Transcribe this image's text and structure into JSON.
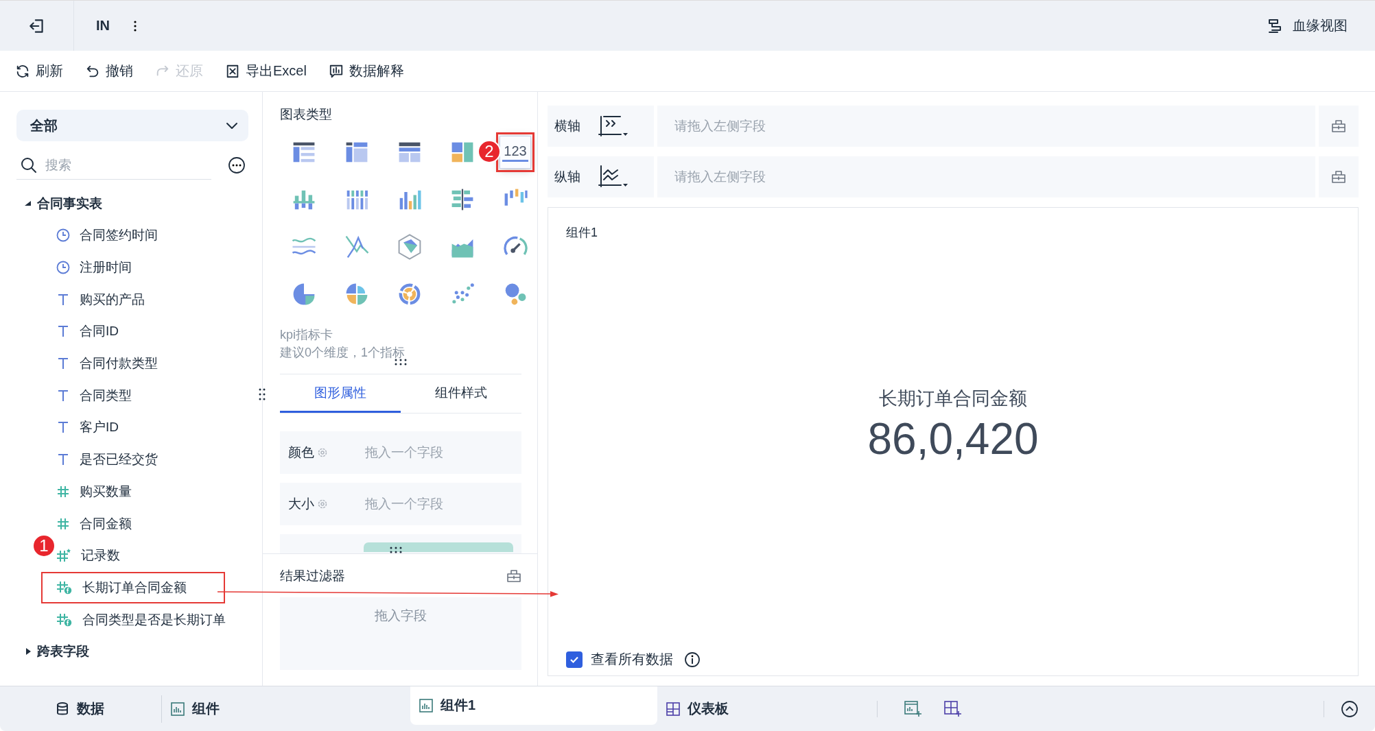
{
  "top_bar": {
    "title": "IN",
    "lineage_button": "血缘视图"
  },
  "toolbar": [
    {
      "label": "刷新",
      "kind": "refresh",
      "disabled": false
    },
    {
      "label": "撤销",
      "kind": "undo",
      "disabled": false
    },
    {
      "label": "还原",
      "kind": "redo",
      "disabled": true
    },
    {
      "label": "导出Excel",
      "kind": "excel",
      "disabled": false
    },
    {
      "label": "数据解释",
      "kind": "explain",
      "disabled": false
    }
  ],
  "field_panel": {
    "filter": "全部",
    "search_placeholder": "搜索",
    "tree": [
      {
        "label": "合同事实表",
        "expanded": true,
        "children": [
          {
            "label": "合同签约时间",
            "kind": "date"
          },
          {
            "label": "注册时间",
            "kind": "date"
          },
          {
            "label": "购买的产品",
            "kind": "text"
          },
          {
            "label": "合同ID",
            "kind": "text"
          },
          {
            "label": "合同付款类型",
            "kind": "text"
          },
          {
            "label": "合同类型",
            "kind": "text"
          },
          {
            "label": "客户ID",
            "kind": "text"
          },
          {
            "label": "是否已经交货",
            "kind": "text"
          },
          {
            "label": "购买数量",
            "kind": "number"
          },
          {
            "label": "合同金额",
            "kind": "number"
          },
          {
            "label": "记录数",
            "kind": "count",
            "badge": "1"
          },
          {
            "label": "长期订单合同金额",
            "kind": "calc",
            "highlighted": true
          },
          {
            "label": "合同类型是否是长期订单",
            "kind": "calc"
          }
        ]
      },
      {
        "label": "跨表字段",
        "expanded": false
      }
    ]
  },
  "chart_types": {
    "title": "图表类型",
    "types": [
      {
        "kind": "table",
        "selected": false
      },
      {
        "kind": "cross-table",
        "selected": false
      },
      {
        "kind": "detail-table",
        "selected": false
      },
      {
        "kind": "treemap",
        "selected": false
      },
      {
        "kind": "kpi",
        "glyph": "123",
        "selected": true,
        "highlighted": true,
        "badge": "2"
      },
      {
        "kind": "grouped-bar",
        "selected": false
      },
      {
        "kind": "stacked-column",
        "selected": false
      },
      {
        "kind": "column",
        "selected": false
      },
      {
        "kind": "horizontal-bar",
        "selected": false
      },
      {
        "kind": "waterfall",
        "selected": false
      },
      {
        "kind": "wave",
        "selected": false
      },
      {
        "kind": "line",
        "selected": false
      },
      {
        "kind": "radar",
        "selected": false
      },
      {
        "kind": "area",
        "selected": false
      },
      {
        "kind": "gauge",
        "selected": false
      },
      {
        "kind": "pie",
        "selected": false
      },
      {
        "kind": "rose",
        "selected": false
      },
      {
        "kind": "sunburst",
        "selected": false
      },
      {
        "kind": "scatter",
        "selected": false
      },
      {
        "kind": "bubble",
        "selected": false
      }
    ],
    "description": [
      "kpi指标卡",
      "建议0个维度，1个指标"
    ]
  },
  "property_tabs": [
    {
      "label": "图形属性",
      "selected": true
    },
    {
      "label": "组件样式",
      "selected": false
    }
  ],
  "properties": [
    {
      "label": "颜色",
      "placeholder": "拖入一个字段"
    },
    {
      "label": "大小",
      "placeholder": "拖入一个字段"
    }
  ],
  "result_filter": {
    "title": "结果过滤器",
    "placeholder": "拖入字段"
  },
  "axes": [
    {
      "label": "横轴",
      "kind": "x",
      "placeholder": "请拖入左侧字段"
    },
    {
      "label": "纵轴",
      "kind": "y",
      "placeholder": "请拖入左侧字段"
    }
  ],
  "component": {
    "title": "组件1",
    "kpi_label": "长期订单合同金额",
    "kpi_value": "86,0,420",
    "view_all": {
      "label": "查看所有数据",
      "checked": true
    }
  },
  "bottom_tabs": [
    {
      "label": "数据",
      "kind": "data",
      "selected": false
    },
    {
      "label": "组件",
      "kind": "chart",
      "selected": false
    },
    {
      "label": "组件1",
      "kind": "chart",
      "selected": true
    },
    {
      "label": "仪表板",
      "kind": "dashboard",
      "selected": false
    }
  ]
}
